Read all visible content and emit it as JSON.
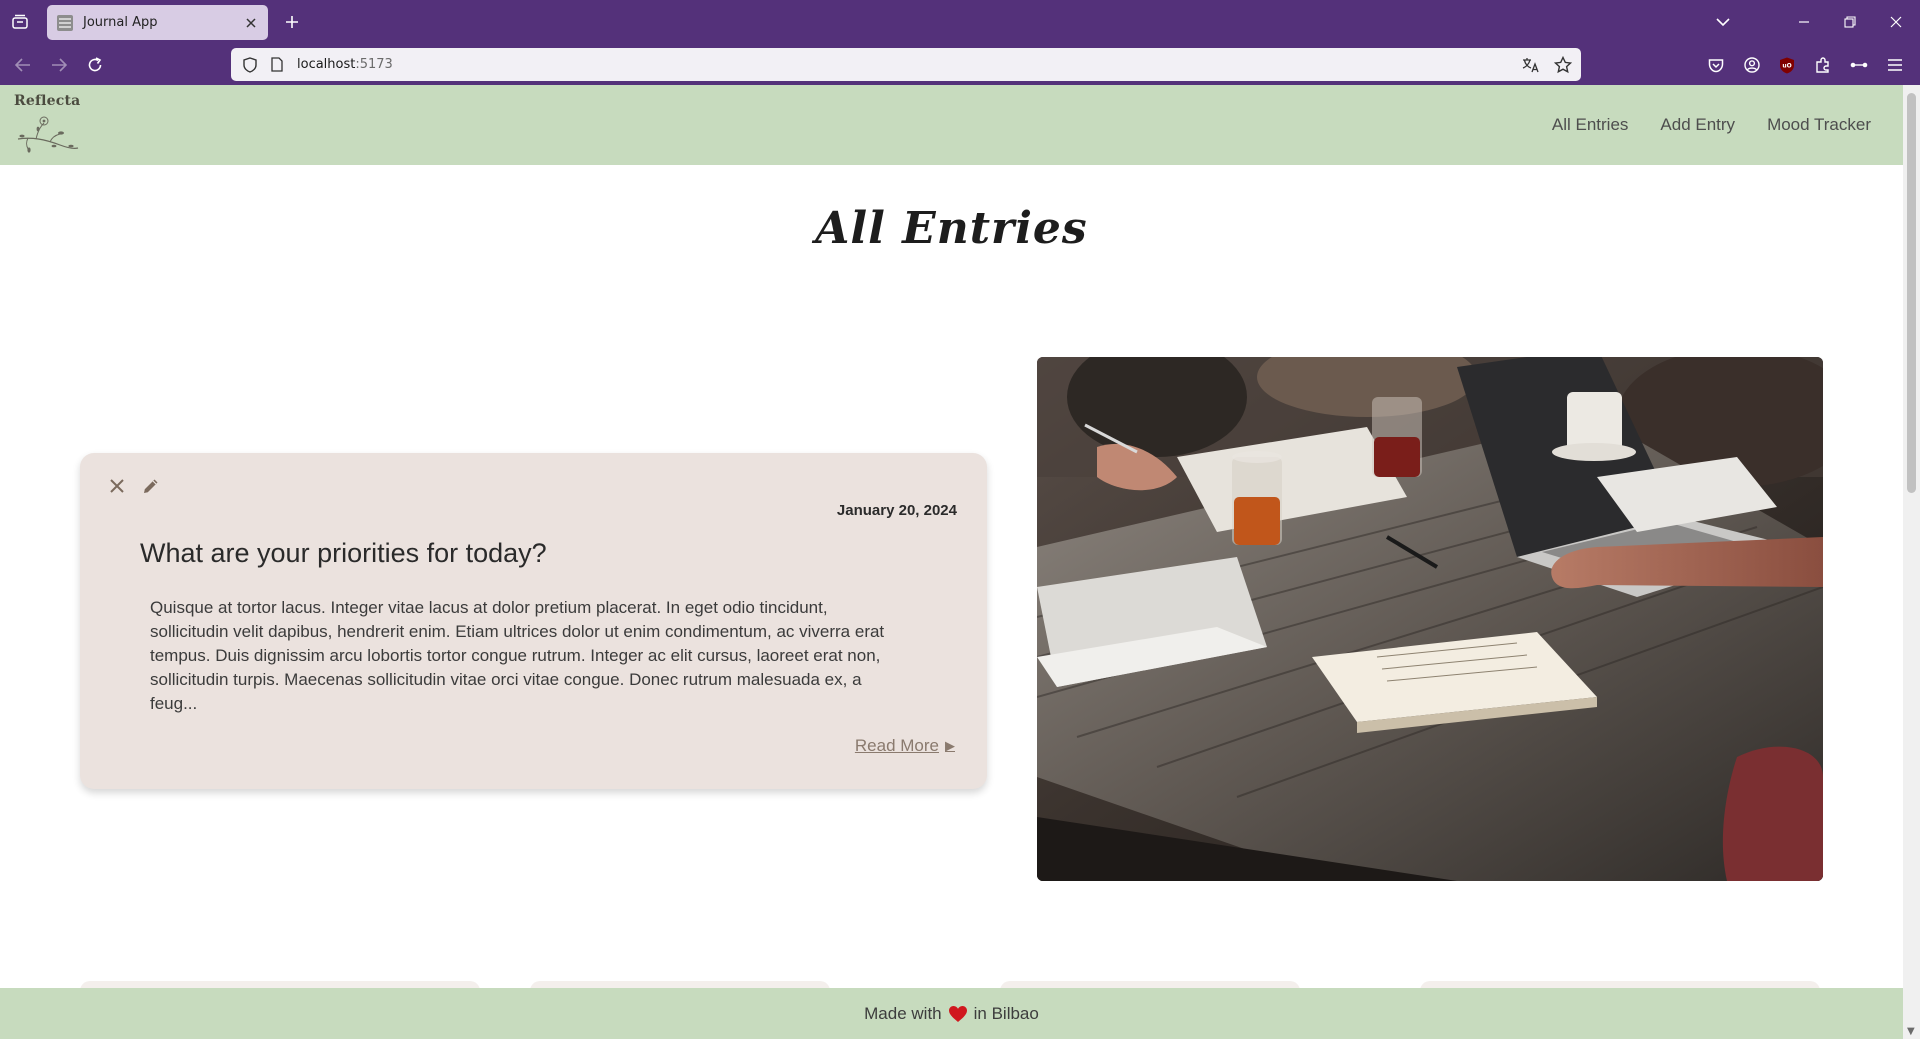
{
  "browser": {
    "tab_title": "Journal App",
    "url_host": "localhost",
    "url_port": ":5173"
  },
  "site": {
    "logo_text": "Reflecta",
    "nav": [
      "All Entries",
      "Add Entry",
      "Mood Tracker"
    ]
  },
  "page": {
    "title": "All Entries"
  },
  "entry": {
    "date": "January 20, 2024",
    "title": "What are your priorities for today?",
    "excerpt": "Quisque at tortor lacus. Integer vitae lacus at dolor pretium placerat. In eget odio tincidunt, sollicitudin velit dapibus, hendrerit enim. Etiam ultrices dolor ut enim condimentum, ac viverra erat tempus. Duis dignissim arcu lobortis tortor congue rutrum. Integer ac elit cursus, laoreet erat non, sollicitudin turpis. Maecenas sollicitudin vitae orci vitae congue. Donec rutrum malesuada ex, a feug...",
    "read_more": "Read More"
  },
  "footer": {
    "before": "Made with",
    "after": "in Bilbao"
  },
  "colors": {
    "browser_chrome": "#54317a",
    "header_bg": "#c7dbbe",
    "card_bg": "#ebe2de",
    "heart": "#d0181e"
  },
  "icons": [
    "tab-list-icon",
    "close-tab-icon",
    "new-tab-icon",
    "back-icon",
    "forward-icon",
    "reload-icon",
    "shield-icon",
    "page-icon",
    "translate-icon",
    "bookmark-star-icon",
    "pocket-icon",
    "account-icon",
    "ublock-icon",
    "extensions-icon",
    "more-tools-icon",
    "menu-icon",
    "delete-icon",
    "edit-pencil-icon",
    "heart-icon"
  ]
}
